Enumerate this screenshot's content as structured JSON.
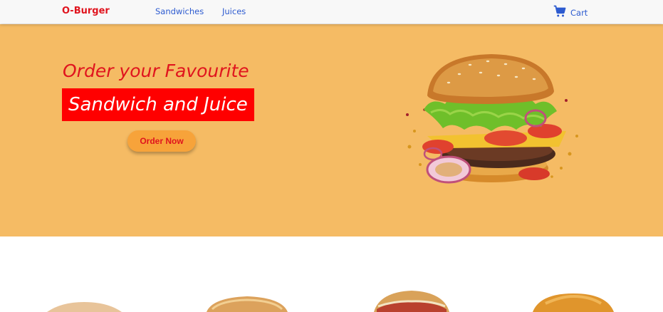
{
  "navbar": {
    "brand": "O-Burger",
    "links": [
      "Sandwiches",
      "Juices"
    ],
    "cart_label": "Cart",
    "cart_icon": "cart-icon"
  },
  "hero": {
    "line1": "Order your Favourite",
    "line2": "Sandwich and Juice",
    "button_label": "Order Now",
    "image": "burger-image"
  },
  "colors": {
    "brand_red": "#e0141e",
    "link_blue": "#2d5bd0",
    "hero_bg": "#f5bb64",
    "button_bg": "#f7a33a",
    "highlight_red": "#ff0000"
  },
  "products": {
    "images": [
      "sandwich-image-1",
      "sandwich-image-2",
      "sandwich-image-3",
      "bun-image-4"
    ]
  }
}
